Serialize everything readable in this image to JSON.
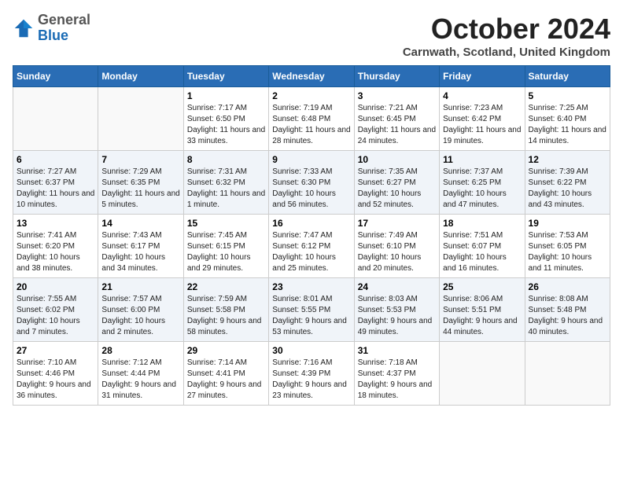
{
  "header": {
    "logo": {
      "general": "General",
      "blue": "Blue"
    },
    "title": "October 2024",
    "location": "Carnwath, Scotland, United Kingdom"
  },
  "columns": [
    "Sunday",
    "Monday",
    "Tuesday",
    "Wednesday",
    "Thursday",
    "Friday",
    "Saturday"
  ],
  "weeks": [
    [
      {
        "day": "",
        "sunrise": "",
        "sunset": "",
        "daylight": ""
      },
      {
        "day": "",
        "sunrise": "",
        "sunset": "",
        "daylight": ""
      },
      {
        "day": "1",
        "sunrise": "Sunrise: 7:17 AM",
        "sunset": "Sunset: 6:50 PM",
        "daylight": "Daylight: 11 hours and 33 minutes."
      },
      {
        "day": "2",
        "sunrise": "Sunrise: 7:19 AM",
        "sunset": "Sunset: 6:48 PM",
        "daylight": "Daylight: 11 hours and 28 minutes."
      },
      {
        "day": "3",
        "sunrise": "Sunrise: 7:21 AM",
        "sunset": "Sunset: 6:45 PM",
        "daylight": "Daylight: 11 hours and 24 minutes."
      },
      {
        "day": "4",
        "sunrise": "Sunrise: 7:23 AM",
        "sunset": "Sunset: 6:42 PM",
        "daylight": "Daylight: 11 hours and 19 minutes."
      },
      {
        "day": "5",
        "sunrise": "Sunrise: 7:25 AM",
        "sunset": "Sunset: 6:40 PM",
        "daylight": "Daylight: 11 hours and 14 minutes."
      }
    ],
    [
      {
        "day": "6",
        "sunrise": "Sunrise: 7:27 AM",
        "sunset": "Sunset: 6:37 PM",
        "daylight": "Daylight: 11 hours and 10 minutes."
      },
      {
        "day": "7",
        "sunrise": "Sunrise: 7:29 AM",
        "sunset": "Sunset: 6:35 PM",
        "daylight": "Daylight: 11 hours and 5 minutes."
      },
      {
        "day": "8",
        "sunrise": "Sunrise: 7:31 AM",
        "sunset": "Sunset: 6:32 PM",
        "daylight": "Daylight: 11 hours and 1 minute."
      },
      {
        "day": "9",
        "sunrise": "Sunrise: 7:33 AM",
        "sunset": "Sunset: 6:30 PM",
        "daylight": "Daylight: 10 hours and 56 minutes."
      },
      {
        "day": "10",
        "sunrise": "Sunrise: 7:35 AM",
        "sunset": "Sunset: 6:27 PM",
        "daylight": "Daylight: 10 hours and 52 minutes."
      },
      {
        "day": "11",
        "sunrise": "Sunrise: 7:37 AM",
        "sunset": "Sunset: 6:25 PM",
        "daylight": "Daylight: 10 hours and 47 minutes."
      },
      {
        "day": "12",
        "sunrise": "Sunrise: 7:39 AM",
        "sunset": "Sunset: 6:22 PM",
        "daylight": "Daylight: 10 hours and 43 minutes."
      }
    ],
    [
      {
        "day": "13",
        "sunrise": "Sunrise: 7:41 AM",
        "sunset": "Sunset: 6:20 PM",
        "daylight": "Daylight: 10 hours and 38 minutes."
      },
      {
        "day": "14",
        "sunrise": "Sunrise: 7:43 AM",
        "sunset": "Sunset: 6:17 PM",
        "daylight": "Daylight: 10 hours and 34 minutes."
      },
      {
        "day": "15",
        "sunrise": "Sunrise: 7:45 AM",
        "sunset": "Sunset: 6:15 PM",
        "daylight": "Daylight: 10 hours and 29 minutes."
      },
      {
        "day": "16",
        "sunrise": "Sunrise: 7:47 AM",
        "sunset": "Sunset: 6:12 PM",
        "daylight": "Daylight: 10 hours and 25 minutes."
      },
      {
        "day": "17",
        "sunrise": "Sunrise: 7:49 AM",
        "sunset": "Sunset: 6:10 PM",
        "daylight": "Daylight: 10 hours and 20 minutes."
      },
      {
        "day": "18",
        "sunrise": "Sunrise: 7:51 AM",
        "sunset": "Sunset: 6:07 PM",
        "daylight": "Daylight: 10 hours and 16 minutes."
      },
      {
        "day": "19",
        "sunrise": "Sunrise: 7:53 AM",
        "sunset": "Sunset: 6:05 PM",
        "daylight": "Daylight: 10 hours and 11 minutes."
      }
    ],
    [
      {
        "day": "20",
        "sunrise": "Sunrise: 7:55 AM",
        "sunset": "Sunset: 6:02 PM",
        "daylight": "Daylight: 10 hours and 7 minutes."
      },
      {
        "day": "21",
        "sunrise": "Sunrise: 7:57 AM",
        "sunset": "Sunset: 6:00 PM",
        "daylight": "Daylight: 10 hours and 2 minutes."
      },
      {
        "day": "22",
        "sunrise": "Sunrise: 7:59 AM",
        "sunset": "Sunset: 5:58 PM",
        "daylight": "Daylight: 9 hours and 58 minutes."
      },
      {
        "day": "23",
        "sunrise": "Sunrise: 8:01 AM",
        "sunset": "Sunset: 5:55 PM",
        "daylight": "Daylight: 9 hours and 53 minutes."
      },
      {
        "day": "24",
        "sunrise": "Sunrise: 8:03 AM",
        "sunset": "Sunset: 5:53 PM",
        "daylight": "Daylight: 9 hours and 49 minutes."
      },
      {
        "day": "25",
        "sunrise": "Sunrise: 8:06 AM",
        "sunset": "Sunset: 5:51 PM",
        "daylight": "Daylight: 9 hours and 44 minutes."
      },
      {
        "day": "26",
        "sunrise": "Sunrise: 8:08 AM",
        "sunset": "Sunset: 5:48 PM",
        "daylight": "Daylight: 9 hours and 40 minutes."
      }
    ],
    [
      {
        "day": "27",
        "sunrise": "Sunrise: 7:10 AM",
        "sunset": "Sunset: 4:46 PM",
        "daylight": "Daylight: 9 hours and 36 minutes."
      },
      {
        "day": "28",
        "sunrise": "Sunrise: 7:12 AM",
        "sunset": "Sunset: 4:44 PM",
        "daylight": "Daylight: 9 hours and 31 minutes."
      },
      {
        "day": "29",
        "sunrise": "Sunrise: 7:14 AM",
        "sunset": "Sunset: 4:41 PM",
        "daylight": "Daylight: 9 hours and 27 minutes."
      },
      {
        "day": "30",
        "sunrise": "Sunrise: 7:16 AM",
        "sunset": "Sunset: 4:39 PM",
        "daylight": "Daylight: 9 hours and 23 minutes."
      },
      {
        "day": "31",
        "sunrise": "Sunrise: 7:18 AM",
        "sunset": "Sunset: 4:37 PM",
        "daylight": "Daylight: 9 hours and 18 minutes."
      },
      {
        "day": "",
        "sunrise": "",
        "sunset": "",
        "daylight": ""
      },
      {
        "day": "",
        "sunrise": "",
        "sunset": "",
        "daylight": ""
      }
    ]
  ]
}
